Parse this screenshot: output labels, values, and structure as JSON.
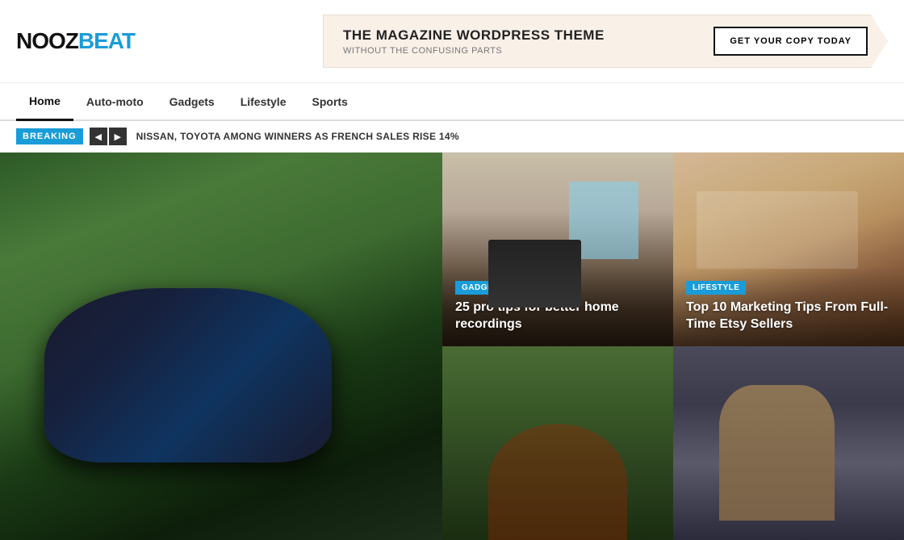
{
  "header": {
    "logo_black": "NOOZ",
    "logo_blue": "BEAT",
    "ad": {
      "title": "THE MAGAZINE WORDPRESS THEME",
      "subtitle": "WITHOUT THE CONFUSING PARTS",
      "cta": "GET YOUR COPY TODAY"
    }
  },
  "nav": {
    "items": [
      {
        "label": "Home",
        "active": true
      },
      {
        "label": "Auto-moto",
        "active": false
      },
      {
        "label": "Gadgets",
        "active": false
      },
      {
        "label": "Lifestyle",
        "active": false
      },
      {
        "label": "Sports",
        "active": false
      }
    ]
  },
  "breaking": {
    "badge": "BREAKING",
    "prev_label": "◀",
    "next_label": "▶",
    "text": "NISSAN, TOYOTA AMONG WINNERS AS FRENCH SALES RISE 14%"
  },
  "cards": [
    {
      "id": "main-car",
      "type": "main",
      "category": null,
      "title": null,
      "img_type": "car"
    },
    {
      "id": "desk",
      "type": "top-right-1",
      "category": "GADGETS",
      "category_class": "badge-gadgets",
      "title": "25 pro tips for better home recordings",
      "img_type": "desk"
    },
    {
      "id": "art",
      "type": "top-right-2",
      "category": "LIFESTYLE",
      "category_class": "badge-lifestyle",
      "title": "Top 10 Marketing Tips From Full-Time Etsy Sellers",
      "img_type": "art"
    },
    {
      "id": "football",
      "type": "bottom-right-1",
      "category": null,
      "title": null,
      "img_type": "football"
    },
    {
      "id": "building",
      "type": "bottom-right-2",
      "category": null,
      "title": null,
      "img_type": "building"
    }
  ]
}
